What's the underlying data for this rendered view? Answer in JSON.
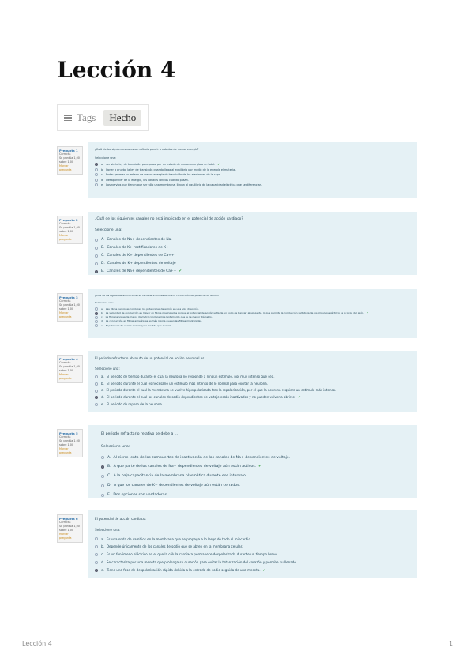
{
  "page_title": "Lección 4",
  "tags": {
    "label": "Tags",
    "value": "Hecho"
  },
  "questions": [
    {
      "number": "Pregunta 1",
      "status": "Correcta",
      "score": "Se puntúa 1,00 sobre 1,00",
      "flag": "Marcar pregunta",
      "text": "¿Cuál de los siguientes no es un método para ir a estados de menor energía?",
      "select_label": "Seleccione una:",
      "options": [
        {
          "letter": "a.",
          "text": "ser sin la ley de transición para pasar por un estado de menor energía a un total.",
          "selected": true,
          "correct": true
        },
        {
          "letter": "b.",
          "text": "Poner a prueba la ley de transición cuando llega al equilibrio por medio de la energía el material.",
          "selected": false,
          "correct": false
        },
        {
          "letter": "c.",
          "text": "Poder generar un estado de menor energía de transición de los electrones de la capa.",
          "selected": false,
          "correct": false
        },
        {
          "letter": "d.",
          "text": "Desaparecer de la energía, los canales iónicos cuando pasan.",
          "selected": false,
          "correct": false
        },
        {
          "letter": "e.",
          "text": "Los nervios que tienen que ser sólo una membrana, llegan al equilibrio de la capacidad eléctrica que se diferencian.",
          "selected": false,
          "correct": false
        }
      ]
    },
    {
      "number": "Pregunta 2",
      "status": "Correcta",
      "score": "Se puntúa 1,00 sobre 1,00",
      "flag": "Marcar pregunta",
      "text": "¿Cuál de los siguientes canales no está implicado en el potencial de acción cardiaco?",
      "select_label": "Seleccione una:",
      "options": [
        {
          "letter": "A.",
          "text": "Canales de Na+ dependientes de Na.",
          "selected": false,
          "correct": false
        },
        {
          "letter": "B.",
          "text": "Canales de K+ rectificadores de K+",
          "selected": false,
          "correct": false
        },
        {
          "letter": "C.",
          "text": "Canales de K+ dependientes de Ca++",
          "selected": false,
          "correct": false
        },
        {
          "letter": "D.",
          "text": "Canales de K+ dependientes de voltaje",
          "selected": false,
          "correct": false
        },
        {
          "letter": "E.",
          "text": "Canales de Na+ dependientes de Ca++",
          "selected": true,
          "correct": true
        }
      ]
    },
    {
      "number": "Pregunta 3",
      "status": "Correcta",
      "score": "Se puntúa 1,00 sobre 1,00",
      "flag": "Marcar pregunta",
      "text": "¿Cuál de las siguientes afirmaciones es verdadera con respecto a la conducción del potencial de acción?",
      "select_label": "Seleccione una:",
      "options": [
        {
          "letter": "a.",
          "text": "Las fibras nerviosas conducen los potenciales de acción en una sola dirección.",
          "selected": false,
          "correct": false
        },
        {
          "letter": "b.",
          "text": "La velocidad de conducción es mayor en fibras mielinizadas porque el potencial de acción salta de un nodo de Ranvier al siguiente, lo que permite la conducción saltatoria de los impulsos eléctricos a lo largo del axón.",
          "selected": true,
          "correct": true
        },
        {
          "letter": "c.",
          "text": "La fibra nerviosa de mayor diámetro conduce más lentamente que la de menor diámetro.",
          "selected": false,
          "correct": false
        },
        {
          "letter": "d.",
          "text": "La conducción en fibras amielínicas es más rápida que en las fibras mielinizadas.",
          "selected": false,
          "correct": false
        },
        {
          "letter": "e.",
          "text": "El potencial de acción disminuye a medida que avanza.",
          "selected": false,
          "correct": false
        }
      ]
    },
    {
      "number": "Pregunta 4",
      "status": "Correcta",
      "score": "Se puntúa 1,00 sobre 1,00",
      "flag": "Marcar pregunta",
      "text": "El periodo refractario absoluto de un potencial de acción neuronal es...",
      "select_label": "Seleccione una:",
      "options": [
        {
          "letter": "a.",
          "text": "El periodo de tiempo durante el cual la neurona no responde a ningún estímulo, por muy intenso que sea.",
          "selected": false,
          "correct": false
        },
        {
          "letter": "b.",
          "text": "El periodo durante el cual es necesario un estímulo más intenso de lo normal para excitar la neurona.",
          "selected": false,
          "correct": false
        },
        {
          "letter": "c.",
          "text": "El periodo durante el cual la membrana se vuelve hiperpolarizada tras la repolarización, por el que la neurona requiere un estímulo más intenso.",
          "selected": false,
          "correct": false
        },
        {
          "letter": "d.",
          "text": "El periodo durante el cual los canales de sodio dependientes de voltaje están inactivados y no pueden volver a abrirse.",
          "selected": true,
          "correct": true
        },
        {
          "letter": "e.",
          "text": "El periodo de reposo de la neurona.",
          "selected": false,
          "correct": false
        }
      ]
    },
    {
      "number": "Pregunta 5",
      "status": "Correcta",
      "score": "Se puntúa 1,00 sobre 1,00",
      "flag": "Marcar pregunta",
      "text": "El periodo refractario relativo se debe a ...",
      "select_label": "Seleccione una:",
      "options": [
        {
          "letter": "A.",
          "text": "Al cierre lento de los compuertas de inactivación de los canales de Na+ dependientes de voltaje.",
          "selected": false,
          "correct": false
        },
        {
          "letter": "B.",
          "text": "A que parte de los canales de Na+ dependientes de voltaje aún están activos.",
          "selected": true,
          "correct": true
        },
        {
          "letter": "C.",
          "text": "A la baja capacitancia de la membrana plasmática durante ese intervalo.",
          "selected": false,
          "correct": false
        },
        {
          "letter": "D.",
          "text": "A que los canales de K+ dependientes de voltaje aún están cerrados.",
          "selected": false,
          "correct": false
        },
        {
          "letter": "E.",
          "text": "Dos opciones son verdaderas.",
          "selected": false,
          "correct": false
        }
      ]
    },
    {
      "number": "Pregunta 6",
      "status": "Correcta",
      "score": "Se puntúa 1,00 sobre 1,00",
      "flag": "Marcar pregunta",
      "text": "El potencial de acción cardiaco:",
      "select_label": "Seleccione una:",
      "options": [
        {
          "letter": "a.",
          "text": "Es una onda de cambios en la membrana que se propaga a lo largo de todo el miocardio.",
          "selected": false,
          "correct": false
        },
        {
          "letter": "b.",
          "text": "Depende únicamente de los canales de sodio que se abren en la membrana celular.",
          "selected": false,
          "correct": false
        },
        {
          "letter": "c.",
          "text": "Es un fenómeno eléctrico en el que la célula cardiaca permanece despolarizada durante un tiempo breve.",
          "selected": false,
          "correct": false
        },
        {
          "letter": "d.",
          "text": "Se caracteriza por una meseta que prolonga su duración para evitar la tetanización del corazón y permite su llenado.",
          "selected": false,
          "correct": false
        },
        {
          "letter": "e.",
          "text": "Tiene una fase de despolarización rápida debida a la entrada de sodio seguida de una meseta.",
          "selected": true,
          "correct": true
        }
      ]
    }
  ],
  "footer": {
    "left": "Lección 4",
    "page_number": "1"
  }
}
